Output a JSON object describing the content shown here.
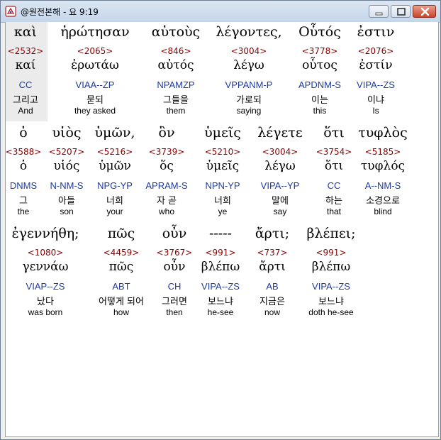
{
  "window": {
    "title": "@원전본해 - 요 9:19",
    "icons": {
      "app": "bible-app-icon",
      "min": "minimize-icon",
      "max": "maximize-icon",
      "close": "close-icon"
    }
  },
  "verse": {
    "words": [
      {
        "greek": "καὶ",
        "strong": "<2532>",
        "lemma": "καί",
        "parse": "CC",
        "korean": "그리고",
        "english": "And"
      },
      {
        "greek": "ἠρώτησαν",
        "strong": "<2065>",
        "lemma": "ἐρωτάω",
        "parse": "VIAA--ZP",
        "korean": "묻되",
        "english": "they asked"
      },
      {
        "greek": "αὐτοὺς",
        "strong": "<846>",
        "lemma": "αὐτός",
        "parse": "NPAMZP",
        "korean": "그들을",
        "english": "them"
      },
      {
        "greek": "λέγοντες,",
        "strong": "<3004>",
        "lemma": "λέγω",
        "parse": "VPPANM-P",
        "korean": "가로되",
        "english": "saying"
      },
      {
        "greek": "Οὗτός",
        "strong": "<3778>",
        "lemma": "οὗτος",
        "parse": "APDNM-S",
        "korean": "이는",
        "english": "this"
      },
      {
        "greek": "ἐστιν",
        "strong": "<2076>",
        "lemma": "ἐστίν",
        "parse": "VIPA--ZS",
        "korean": "이냐",
        "english": "Is"
      },
      {
        "greek": "ὁ",
        "strong": "<3588>",
        "lemma": "ὁ",
        "parse": "DNMS",
        "korean": "그",
        "english": "the"
      },
      {
        "greek": "υἱὸς",
        "strong": "<5207>",
        "lemma": "υἱός",
        "parse": "N-NM-S",
        "korean": "아들",
        "english": "son"
      },
      {
        "greek": "ὑμῶν,",
        "strong": "<5216>",
        "lemma": "ὑμῶν",
        "parse": "NPG-YP",
        "korean": "너희",
        "english": "your"
      },
      {
        "greek": "ὃν",
        "strong": "<3739>",
        "lemma": "ὅς",
        "parse": "APRAM-S",
        "korean": "자 곧",
        "english": "who"
      },
      {
        "greek": "ὑμεῖς",
        "strong": "<5210>",
        "lemma": "ὑμεῖς",
        "parse": "NPN-YP",
        "korean": "너희",
        "english": "ye"
      },
      {
        "greek": "λέγετε",
        "strong": "<3004>",
        "lemma": "λέγω",
        "parse": "VIPA--YP",
        "korean": "말에",
        "english": "say"
      },
      {
        "greek": "ὅτι",
        "strong": "<3754>",
        "lemma": "ὅτι",
        "parse": "CC",
        "korean": "하는",
        "english": "that"
      },
      {
        "greek": "τυφλὸς",
        "strong": "<5185>",
        "lemma": "τυφλός",
        "parse": "A--NM-S",
        "korean": "소경으로",
        "english": "blind"
      },
      {
        "greek": "ἐγεννήθη;",
        "strong": "<1080>",
        "lemma": "γεννάω",
        "parse": "VIAP--ZS",
        "korean": "났다",
        "english": "was born"
      },
      {
        "greek": "πῶς",
        "strong": "<4459>",
        "lemma": "πῶς",
        "parse": "ABT",
        "korean": "어떻게 되어",
        "english": "how"
      },
      {
        "greek": "οὖν",
        "strong": "<3767>",
        "lemma": "οὖν",
        "parse": "CH",
        "korean": "그러면",
        "english": "then"
      },
      {
        "greek": "-----",
        "strong": "<991>",
        "lemma": "βλέπω",
        "parse": "VIPA--ZS",
        "korean": "보느냐",
        "english": "he-see"
      },
      {
        "greek": "ἄρτι;",
        "strong": "<737>",
        "lemma": "ἄρτι",
        "parse": "AB",
        "korean": "지금은",
        "english": "now"
      },
      {
        "greek": "βλέπει;",
        "strong": "<991>",
        "lemma": "βλέπω",
        "parse": "VIPA--ZS",
        "korean": "보느냐",
        "english": "doth he-see"
      }
    ]
  }
}
